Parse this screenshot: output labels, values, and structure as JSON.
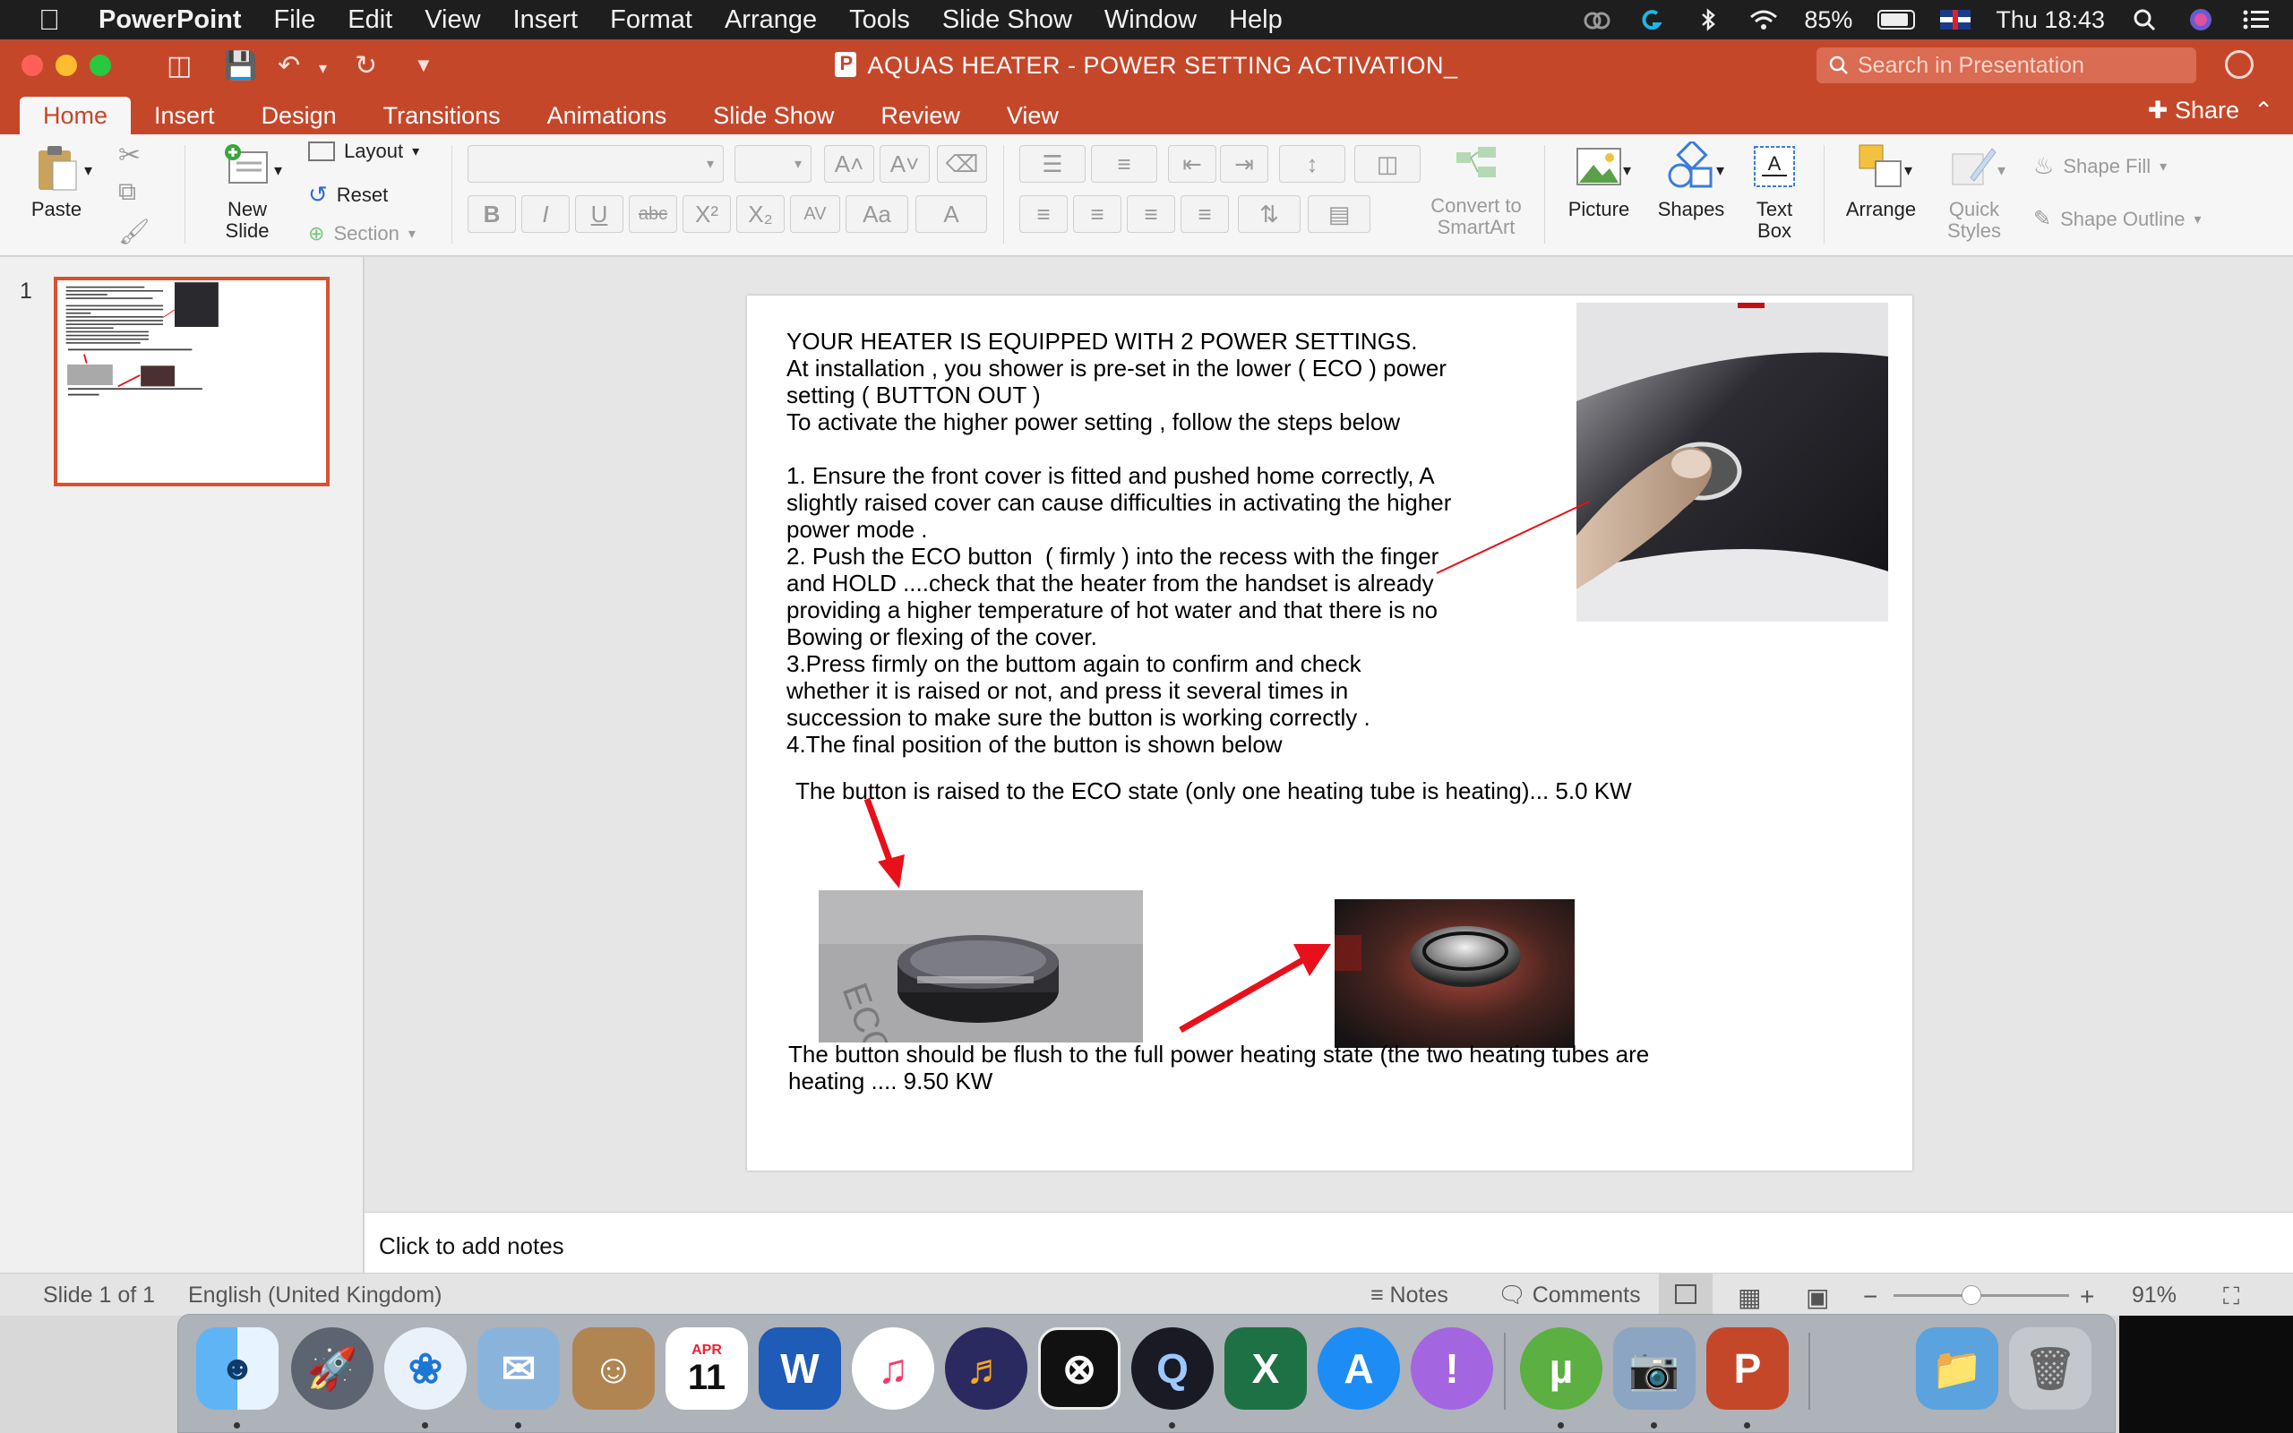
{
  "menubar": {
    "app_name": "PowerPoint",
    "menus": [
      "File",
      "Edit",
      "View",
      "Insert",
      "Format",
      "Arrange",
      "Tools",
      "Slide Show",
      "Window",
      "Help"
    ],
    "battery": "85%",
    "clock": "Thu 18:43"
  },
  "window": {
    "title": "AQUAS HEATER - POWER SETTING ACTIVATION_",
    "search_placeholder": "Search in Presentation"
  },
  "ribbon": {
    "tabs": [
      "Home",
      "Insert",
      "Design",
      "Transitions",
      "Animations",
      "Slide Show",
      "Review",
      "View"
    ],
    "active_tab": "Home",
    "share_label": "Share",
    "paste": "Paste",
    "new_slide_1": "New",
    "new_slide_2": "Slide",
    "layout": "Layout",
    "reset": "Reset",
    "section": "Section",
    "convert_1": "Convert to",
    "convert_2": "SmartArt",
    "picture": "Picture",
    "shapes": "Shapes",
    "textbox_1": "Text",
    "textbox_2": "Box",
    "arrange": "Arrange",
    "quick_1": "Quick",
    "quick_2": "Styles",
    "shape_fill": "Shape Fill",
    "shape_outline": "Shape Outline"
  },
  "slides_panel": {
    "slide_number": "1"
  },
  "slide": {
    "line1": "YOUR HEATER IS EQUIPPED WITH 2 POWER SETTINGS.",
    "line2": "At installation , you shower is pre-set in the lower ( ECO ) power",
    "line3": "setting ( BUTTON OUT )",
    "line4": "To activate the higher power setting , follow the steps below",
    "step1a": "1. Ensure the front cover is fitted and pushed home correctly, A",
    "step1b": "slightly raised cover can cause difficulties in activating the higher",
    "step1c": "power mode .",
    "step2a": "2. Push the ECO button  ( firmly ) into the recess with the finger",
    "step2b": "and HOLD ....check that the heater from the handset is already",
    "step2c": "providing a higher temperature of hot water and that there is no",
    "step2d": "Bowing or flexing of the cover.",
    "step3a": "3.Press firmly on the buttom again to confirm and check",
    "step3b": "whether it is raised or not, and press it several times in",
    "step3c": "succession to make sure the button is working correctly .",
    "step4": "4.The final position of the button is shown below",
    "eco_caption": "The button is raised to the ECO state (only one heating tube is heating)... 5.0 KW",
    "full_caption_1": "The button should be flush to the full power heating state (the two heating tubes are",
    "full_caption_2": "heating .... 9.50 KW",
    "eco_embossed": "ECO"
  },
  "notes": {
    "placeholder": "Click to add notes"
  },
  "status": {
    "slide_of": "Slide 1 of 1",
    "language": "English (United Kingdom)",
    "notes_btn": "Notes",
    "comments_btn": "Comments",
    "zoom": "91%"
  },
  "dock": {
    "calendar_month": "APR",
    "calendar_day": "11"
  }
}
